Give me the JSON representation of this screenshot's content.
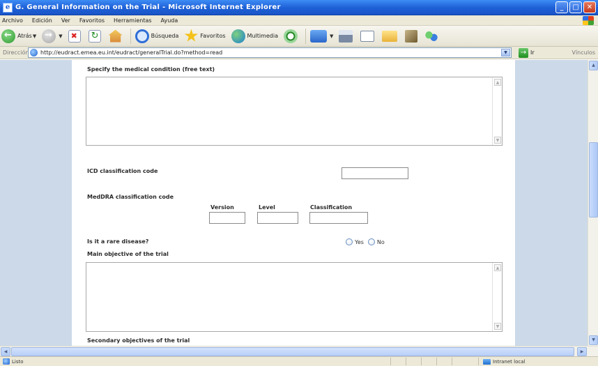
{
  "window": {
    "title": "G. General Information on the Trial - Microsoft Internet Explorer",
    "controls": {
      "minimize": "_",
      "maximize": "□",
      "close": "✕"
    }
  },
  "menu": [
    "Archivo",
    "Edición",
    "Ver",
    "Favoritos",
    "Herramientas",
    "Ayuda"
  ],
  "toolbar": {
    "back_label": "Atrás",
    "search_label": "Búsqueda",
    "favorites_label": "Favoritos",
    "multimedia_label": "Multimedia"
  },
  "address": {
    "label": "Dirección",
    "url": "http://eudract.emea.eu.int/eudract/generalTrial.do?method=read",
    "go_label": "Ir",
    "links_label": "Vínculos"
  },
  "form": {
    "medical_condition_label": "Specify the medical condition (free text)",
    "medical_condition_value": "",
    "icd_label": "ICD classification code",
    "icd_value": "",
    "meddra_label": "MedDRA classification code",
    "meddra_columns": [
      "Version",
      "Level",
      "Classification"
    ],
    "rare_disease_label": "Is it a rare disease?",
    "rare_disease_options": [
      "Yes",
      "No"
    ],
    "main_objective_label": "Main objective of the trial",
    "main_objective_value": "",
    "secondary_objectives_label": "Secondary objectives of the trial"
  },
  "status": {
    "text": "Listo",
    "zone": "Intranet local"
  },
  "colors": {
    "page_side": "#ccd9e8",
    "titlebar": "#1d5fd6"
  }
}
